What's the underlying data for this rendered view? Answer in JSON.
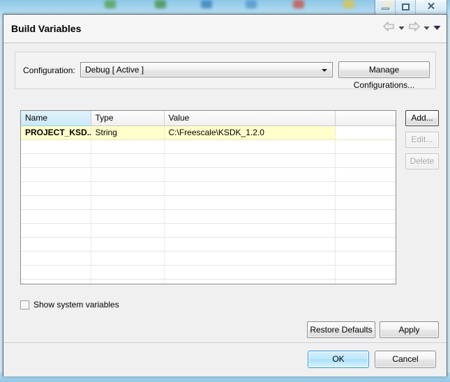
{
  "window": {
    "controls": [
      {
        "name": "minimize",
        "glyph": "minimize-icon"
      },
      {
        "name": "restore",
        "glyph": "restore-icon"
      },
      {
        "name": "close",
        "glyph": "close-icon",
        "label": "✕"
      }
    ]
  },
  "header": {
    "title": "Build Variables",
    "nav": [
      {
        "name": "back-arrow-icon",
        "enabled": false
      },
      {
        "name": "back-dropdown-caret-icon",
        "enabled": false
      },
      {
        "name": "forward-arrow-icon",
        "enabled": false
      },
      {
        "name": "forward-dropdown-caret-icon",
        "enabled": false
      },
      {
        "name": "menu-dropdown-caret-icon",
        "enabled": true
      }
    ]
  },
  "configuration": {
    "label": "Configuration:",
    "selected": "Debug  [ Active ]",
    "options": [
      "Debug  [ Active ]"
    ],
    "manage_label": "Manage Configurations..."
  },
  "table": {
    "columns": [
      "Name",
      "Type",
      "Value",
      ""
    ],
    "sorted_column": "Name",
    "rows": [
      {
        "name": "PROJECT_KSD...",
        "type": "String",
        "value": "C:\\Freescale\\KSDK_1.2.0",
        "extra": "",
        "highlighted": true
      }
    ],
    "empty_row_count": 11
  },
  "side_buttons": [
    {
      "label": "Add...",
      "enabled": true,
      "focused": true
    },
    {
      "label": "Edit...",
      "enabled": false,
      "focused": false
    },
    {
      "label": "Delete",
      "enabled": false,
      "focused": false
    }
  ],
  "show_system_variables": {
    "label": "Show system variables",
    "checked": false
  },
  "lower_buttons": {
    "restore_defaults": "Restore Defaults",
    "apply": "Apply"
  },
  "footer": {
    "ok": "OK",
    "cancel": "Cancel"
  },
  "colors": {
    "dialog_bg": "#f0f0f0",
    "highlight_row": "#ffffcc",
    "sorted_header": "#cbe9f8",
    "default_button": "#bfe8fb",
    "desktop": "#a9d7ef"
  }
}
